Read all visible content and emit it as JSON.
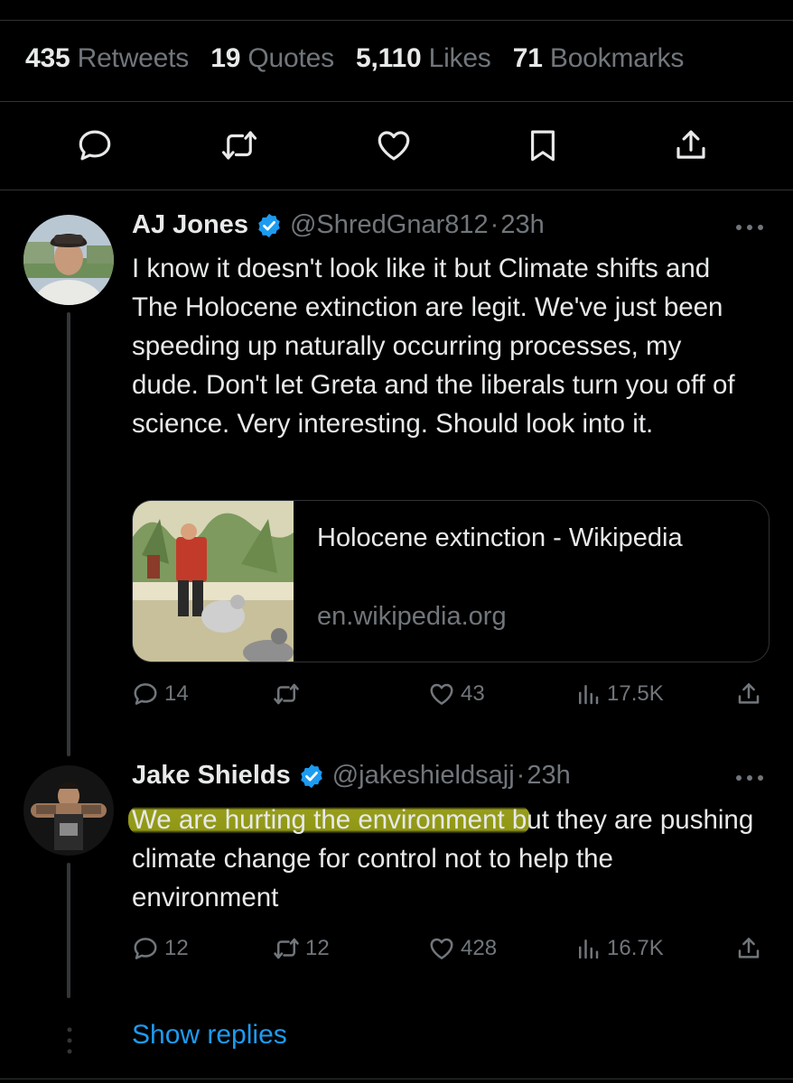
{
  "stats": {
    "retweets": {
      "count": "435",
      "label": "Retweets"
    },
    "quotes": {
      "count": "19",
      "label": "Quotes"
    },
    "likes": {
      "count": "5,110",
      "label": "Likes"
    },
    "bookmarks": {
      "count": "71",
      "label": "Bookmarks"
    }
  },
  "action_bar": {
    "icons": [
      "reply-icon",
      "retweet-icon",
      "like-icon",
      "bookmark-icon",
      "share-icon"
    ]
  },
  "replies": [
    {
      "name": "AJ Jones",
      "handle": "@ShredGnar812",
      "separator": "·",
      "time": "23h",
      "text": "I know it doesn't look like it but Climate shifts and The Holocene extinction are legit. We've just been speeding up naturally occurring processes, my dude. Don't let Greta and the liberals turn you off of science. Very interesting. Should look into it.",
      "card": {
        "title": "Holocene extinction - Wikipedia",
        "domain": "en.wikipedia.org"
      },
      "metrics": {
        "replies": "14",
        "retweets": "",
        "likes": "43",
        "views": "17.5K"
      }
    },
    {
      "name": "Jake Shields",
      "handle": "@jakeshieldsajj",
      "separator": "·",
      "time": "23h",
      "text_highlighted": "We are hurting the environment b",
      "text_rest": "ut they are pushing climate change for control not to help the environment",
      "metrics": {
        "replies": "12",
        "retweets": "12",
        "likes": "428",
        "views": "16.7K"
      }
    }
  ],
  "show_replies": "Show replies",
  "colors": {
    "background": "#000000",
    "text": "#e7e9ea",
    "muted": "#71767b",
    "link": "#1d9bf0",
    "verified": "#1d9bf0",
    "divider": "#2f3336",
    "highlight": "#d2da26"
  }
}
